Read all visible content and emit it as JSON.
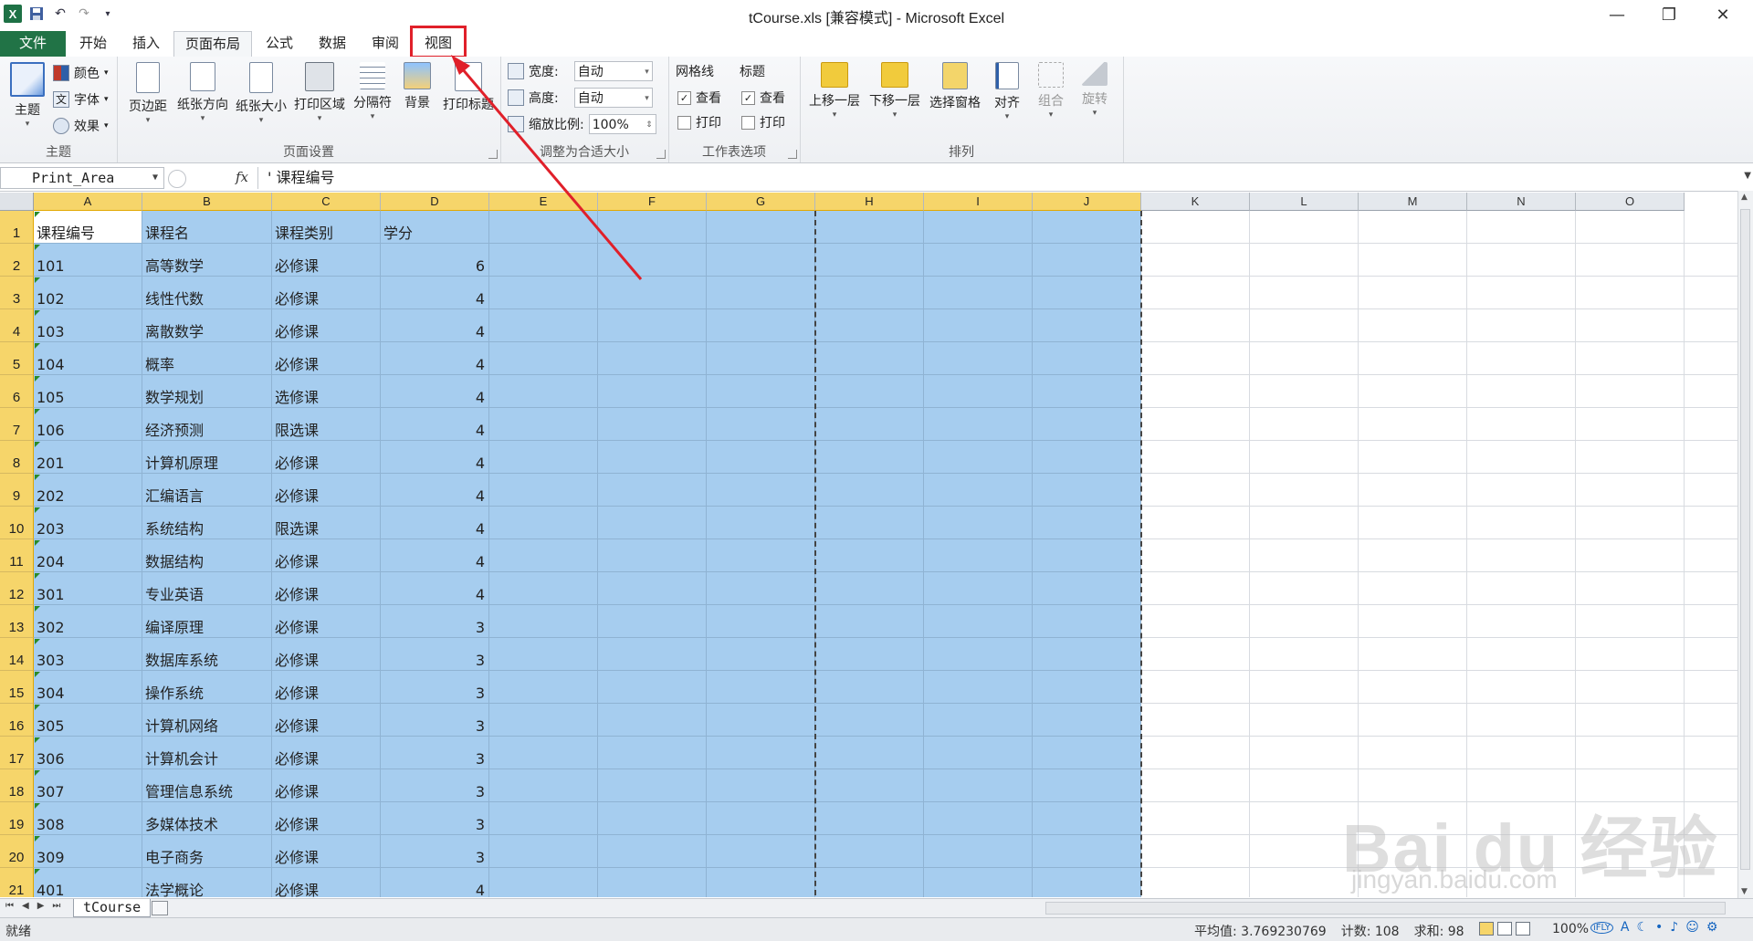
{
  "window": {
    "title": "tCourse.xls  [兼容模式] - Microsoft Excel",
    "qat_logo": "X",
    "minimize": "—",
    "restore": "❐",
    "close": "✕"
  },
  "tabs": [
    {
      "label": "文件"
    },
    {
      "label": "开始"
    },
    {
      "label": "插入"
    },
    {
      "label": "页面布局"
    },
    {
      "label": "公式"
    },
    {
      "label": "数据"
    },
    {
      "label": "审阅"
    },
    {
      "label": "视图"
    }
  ],
  "ribbon": {
    "theme_group": {
      "label": "主题",
      "themes": "主题",
      "colors": "颜色",
      "fonts": "字体",
      "effects": "效果"
    },
    "page_setup_group": {
      "label": "页面设置",
      "margins": "页边距",
      "orientation": "纸张方向",
      "size": "纸张大小",
      "print_area": "打印区域",
      "breaks": "分隔符",
      "background": "背景",
      "print_titles": "打印标题"
    },
    "scale_group": {
      "label": "调整为合适大小",
      "width_label": "宽度:",
      "width_value": "自动",
      "height_label": "高度:",
      "height_value": "自动",
      "scale_label": "缩放比例:",
      "scale_value": "100%"
    },
    "sheet_options_group": {
      "label": "工作表选项",
      "gridlines": "网格线",
      "headings": "标题",
      "view": "查看",
      "print": "打印"
    },
    "arrange_group": {
      "label": "排列",
      "bring_forward": "上移一层",
      "send_backward": "下移一层",
      "selection_pane": "选择窗格",
      "align": "对齐",
      "group": "组合",
      "rotate": "旋转"
    }
  },
  "formula_bar": {
    "name_box": "Print_Area",
    "fx": "fx",
    "content": "' 课程编号"
  },
  "columns": [
    "A",
    "B",
    "C",
    "D",
    "E",
    "F",
    "G",
    "H",
    "I",
    "J",
    "K",
    "L",
    "M",
    "N",
    "O"
  ],
  "rows": [
    "1",
    "2",
    "3",
    "4",
    "5",
    "6",
    "7",
    "8",
    "9",
    "10",
    "11",
    "12",
    "13",
    "14",
    "15",
    "16",
    "17",
    "18",
    "19",
    "20",
    "21"
  ],
  "table": [
    [
      "课程编号",
      "课程名",
      "课程类别",
      "学分"
    ],
    [
      "101",
      "高等数学",
      "必修课",
      "6"
    ],
    [
      "102",
      "线性代数",
      "必修课",
      "4"
    ],
    [
      "103",
      "离散数学",
      "必修课",
      "4"
    ],
    [
      "104",
      "概率",
      "必修课",
      "4"
    ],
    [
      "105",
      "数学规划",
      "选修课",
      "4"
    ],
    [
      "106",
      "经济预测",
      "限选课",
      "4"
    ],
    [
      "201",
      "计算机原理",
      "必修课",
      "4"
    ],
    [
      "202",
      "汇编语言",
      "必修课",
      "4"
    ],
    [
      "203",
      "系统结构",
      "限选课",
      "4"
    ],
    [
      "204",
      "数据结构",
      "必修课",
      "4"
    ],
    [
      "301",
      "专业英语",
      "必修课",
      "4"
    ],
    [
      "302",
      "编译原理",
      "必修课",
      "3"
    ],
    [
      "303",
      "数据库系统",
      "必修课",
      "3"
    ],
    [
      "304",
      "操作系统",
      "必修课",
      "3"
    ],
    [
      "305",
      "计算机网络",
      "必修课",
      "3"
    ],
    [
      "306",
      "计算机会计",
      "必修课",
      "3"
    ],
    [
      "307",
      "管理信息系统",
      "必修课",
      "3"
    ],
    [
      "308",
      "多媒体技术",
      "必修课",
      "3"
    ],
    [
      "309",
      "电子商务",
      "必修课",
      "3"
    ],
    [
      "401",
      "法学概论",
      "必修课",
      "4"
    ]
  ],
  "sheet_tabs": [
    "tCourse"
  ],
  "status": {
    "ready": "就绪",
    "average": "平均值: 3.769230769",
    "count": "计数: 108",
    "sum": "求和: 98",
    "zoom": "100%"
  },
  "watermark": {
    "brand": "Bai du 经验",
    "url": "jingyan.baidu.com"
  },
  "colors": {
    "excel_green": "#217346",
    "selection": "#a6cdef",
    "header_selected": "#f6d56a",
    "annotation_red": "#e0202a"
  }
}
